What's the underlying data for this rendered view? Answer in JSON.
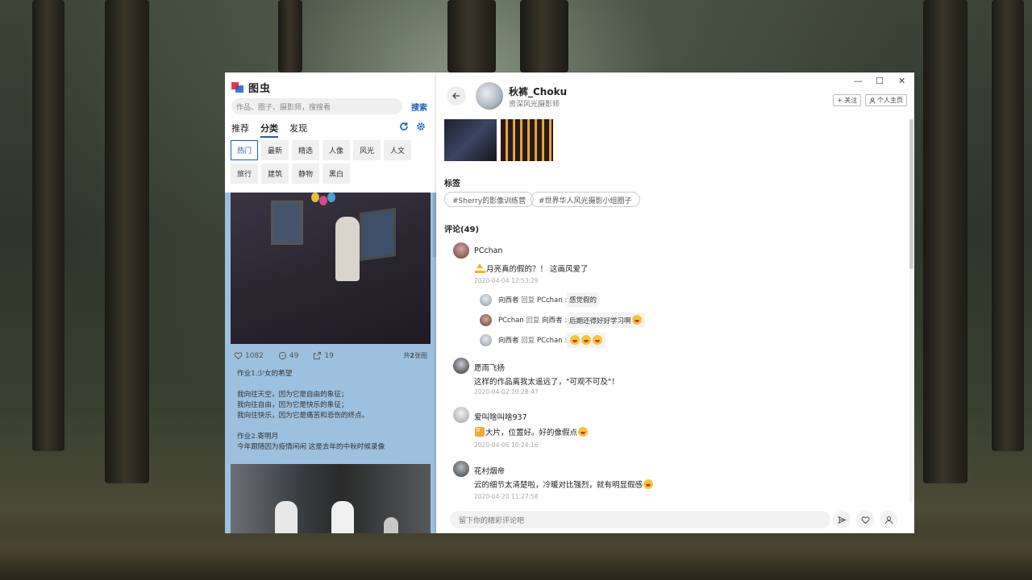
{
  "left_app": {
    "logo_text": "图虫",
    "search_placeholder": "作品、圈子、摄影师，搜搜看",
    "search_button": "搜索",
    "tabs": [
      "推荐",
      "分类",
      "发现"
    ],
    "categories": [
      "热门",
      "最新",
      "精选",
      "人像",
      "风光",
      "人文",
      "旅行",
      "建筑",
      "静物",
      "黑白"
    ],
    "active_category": "热门",
    "post": {
      "likes": "1082",
      "comments": "49",
      "shares": "19",
      "count_prefix": "共",
      "count_num": "2",
      "count_suffix": "张图",
      "text": "作业1.少女的希望\n\n我向往天空，因为它是自由的象征；\n我向往自由，因为它是快乐的象征；\n我向往快乐，因为它是痛苦和悲伤的终点。\n\n作业2.寄明月\n今年跟随因为疫情闲闲 这是去年的中秋时候录像"
    }
  },
  "detail": {
    "window_controls": [
      "—",
      "☐",
      "✕"
    ],
    "author_name": "秋裤_Choku",
    "author_title": "资深风光摄影师",
    "follow_button": "+ 关注",
    "homepage_button": "个人主页",
    "tags_title": "标签",
    "tags": [
      "#Sherry的影像训练营",
      "#世界华人风光摄影小组圈子"
    ],
    "comments_title": "评论(49)",
    "comments": [
      {
        "user": "PCchan",
        "text": "月亮真的假的？！ 这画风爱了",
        "time": "2020-04-04 12:53:29",
        "replies": [
          {
            "user": "向西者",
            "reply_word": "回复",
            "target": "PCchan :",
            "text": "感觉假的"
          },
          {
            "user": "PCchan",
            "reply_word": "回复",
            "target": "向西者 :",
            "text": "后期还得好好学习啊"
          },
          {
            "user": "向西者",
            "reply_word": "回复",
            "target": "PCchan :",
            "text": ""
          }
        ]
      },
      {
        "user": "愿雨飞扬",
        "text": "这样的作品离我太遥远了，\"可观不可及\"！",
        "time": "2020-04-02 10:28:47"
      },
      {
        "user": "爱叫啥叫啥937",
        "text": "大片，位置好。好的像假点",
        "time": "2020-04-06 10:24:16"
      },
      {
        "user": "花村烟帝",
        "text": "云的细节太清楚啦，冷暖对比强烈，就有明显假感",
        "time": "2020-04-20 11:27:58"
      }
    ],
    "comment_placeholder": "留下你的精彩评论吧"
  }
}
